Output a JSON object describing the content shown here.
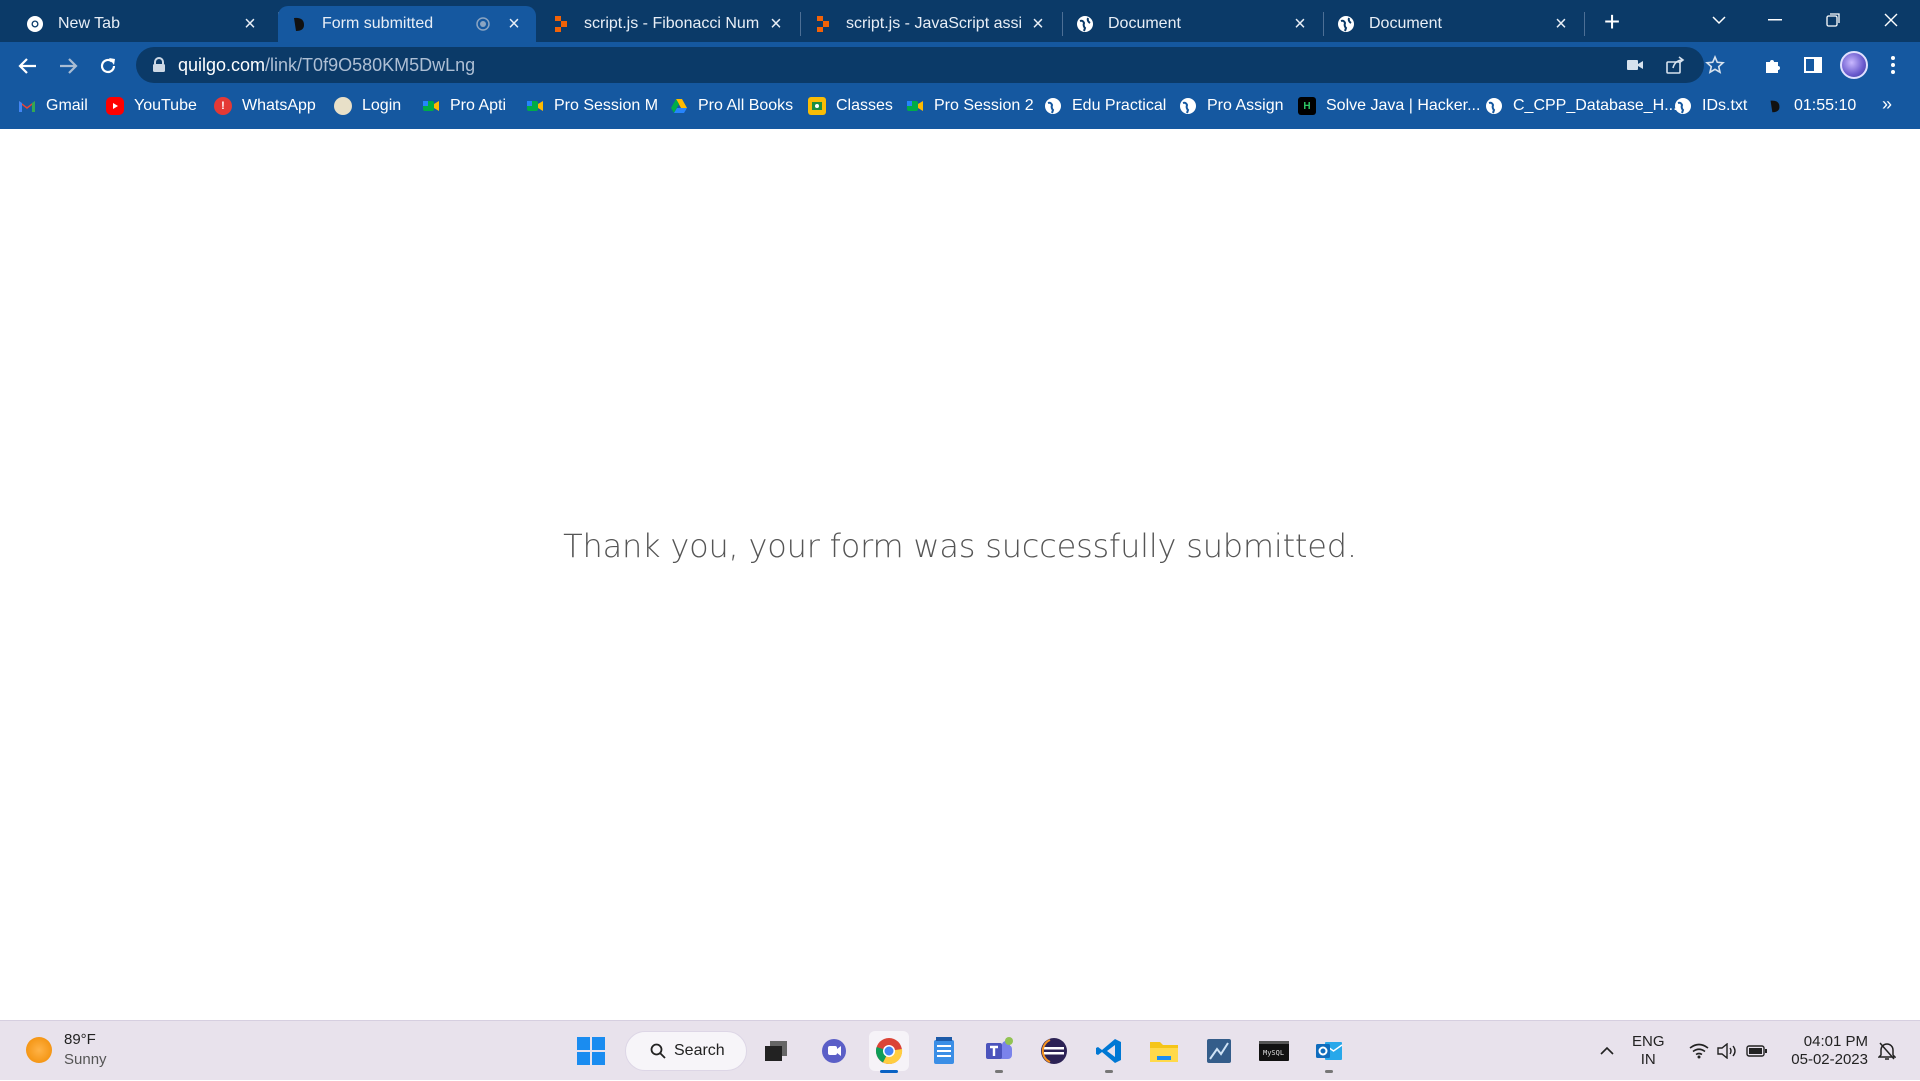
{
  "browser": {
    "tabs": [
      {
        "title": "New Tab",
        "icon": "chrome-icon",
        "active": false
      },
      {
        "title": "Form submitted",
        "icon": "quilgo-icon",
        "active": true
      },
      {
        "title": "script.js - Fibonacci Number",
        "icon": "replit-icon",
        "active": false
      },
      {
        "title": "script.js - JavaScript assignm",
        "icon": "replit-icon",
        "active": false
      },
      {
        "title": "Document",
        "icon": "globe-icon",
        "active": false
      },
      {
        "title": "Document",
        "icon": "globe-icon",
        "active": false
      }
    ],
    "url_host": "quilgo.com",
    "url_path": "/link/T0f9O580KM5DwLng",
    "bookmarks": [
      {
        "label": "Gmail",
        "icon": "gmail-icon"
      },
      {
        "label": "YouTube",
        "icon": "youtube-icon"
      },
      {
        "label": "WhatsApp",
        "icon": "whatsapp-icon"
      },
      {
        "label": "Login",
        "icon": "login-icon"
      },
      {
        "label": "Pro Apti",
        "icon": "meet-icon"
      },
      {
        "label": "Pro Session M",
        "icon": "meet-icon"
      },
      {
        "label": "Pro All Books",
        "icon": "drive-icon"
      },
      {
        "label": "Classes",
        "icon": "classroom-icon"
      },
      {
        "label": "Pro Session 2",
        "icon": "meet-icon"
      },
      {
        "label": "Edu Practical",
        "icon": "globe-icon"
      },
      {
        "label": "Pro Assign",
        "icon": "globe-icon"
      },
      {
        "label": "Solve Java | Hacker...",
        "icon": "hackerrank-icon"
      },
      {
        "label": "C_CPP_Database_H...",
        "icon": "globe-icon"
      },
      {
        "label": "IDs.txt",
        "icon": "globe-icon"
      },
      {
        "label": "01:55:10",
        "icon": "quilgo-icon"
      }
    ]
  },
  "page": {
    "message": "Thank you, your form was successfully submitted."
  },
  "taskbar": {
    "weather_temp": "89°F",
    "weather_desc": "Sunny",
    "search_label": "Search",
    "lang_line1": "ENG",
    "lang_line2": "IN",
    "time": "04:01 PM",
    "date": "05-02-2023"
  },
  "colors": {
    "titlebar": "#0b3a68",
    "toolbar": "#1558a0",
    "taskbar": "#e8e2ec"
  }
}
